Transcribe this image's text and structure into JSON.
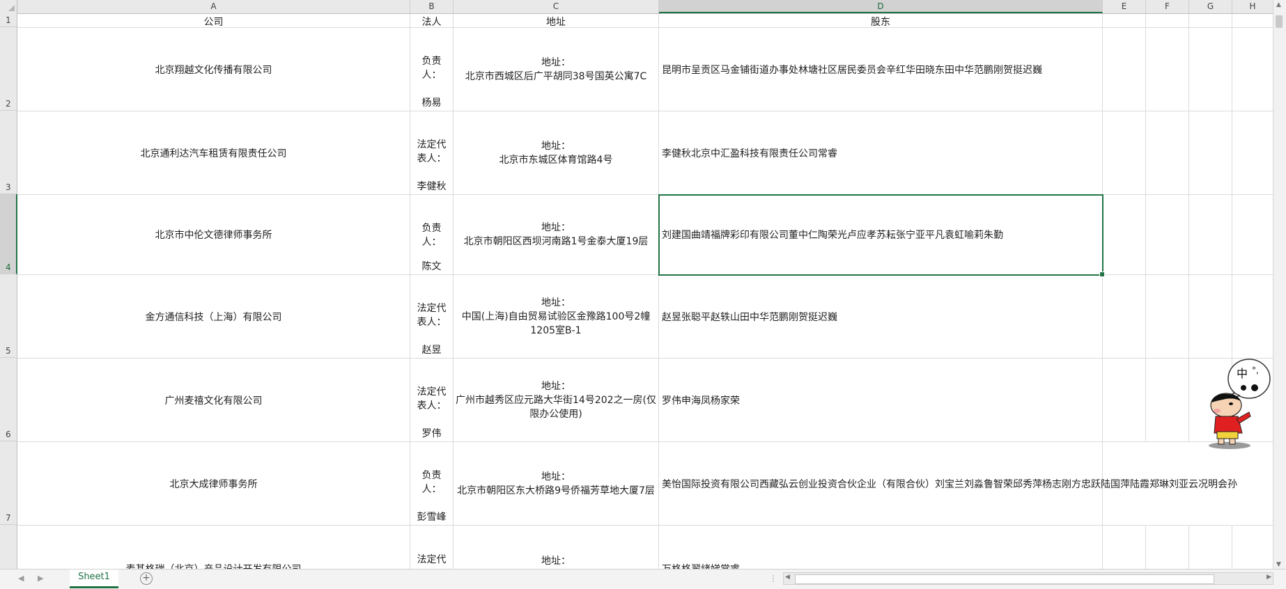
{
  "columns": [
    "A",
    "B",
    "C",
    "D",
    "E",
    "F",
    "G",
    "H"
  ],
  "active_column": "D",
  "row_numbers": [
    "1",
    "2",
    "3",
    "4",
    "5",
    "6",
    "7"
  ],
  "active_row": "4",
  "headers": {
    "company": "公司",
    "person": "法人",
    "address": "地址",
    "shareholder": "股东"
  },
  "rows": [
    {
      "company": "北京翔越文化传播有限公司",
      "role": "负责人：",
      "person": "杨易",
      "address_label": "地址：",
      "address": "北京市西城区后广平胡同38号国英公寓7C",
      "shareholder": "昆明市呈贡区马金铺街道办事处林塘社区居民委员会辛红华田晓东田中华范鹏刚贺挺迟巍"
    },
    {
      "company": "北京通利达汽车租赁有限责任公司",
      "role": "法定代表人：",
      "person": "李健秋",
      "address_label": "地址：",
      "address": "北京市东城区体育馆路4号",
      "shareholder": "李健秋北京中汇盈科技有限责任公司常睿"
    },
    {
      "company": "北京市中伦文德律师事务所",
      "role": "负责人：",
      "person": "陈文",
      "address_label": "地址：",
      "address": "北京市朝阳区西坝河南路1号金泰大厦19层",
      "shareholder": "刘建国曲靖福牌彩印有限公司董中仁陶荣光卢应孝苏耘张宁亚平凡袁虹喻莉朱勤"
    },
    {
      "company": "金方通信科技（上海）有限公司",
      "role": "法定代表人：",
      "person": "赵昱",
      "address_label": "地址：",
      "address": "中国(上海)自由贸易试验区金豫路100号2幢1205室B-1",
      "shareholder": "赵昱张聪平赵轶山田中华范鹏刚贺挺迟巍"
    },
    {
      "company": "广州麦禧文化有限公司",
      "role": "法定代表人：",
      "person": "罗伟",
      "address_label": "地址：",
      "address": "广州市越秀区应元路大华街14号202之一房(仅限办公使用)",
      "shareholder": "罗伟申海凤杨家荣"
    },
    {
      "company": "北京大成律师事务所",
      "role": "负责人：",
      "person": "彭雪峰",
      "address_label": "地址：",
      "address": "北京市朝阳区东大桥路9号侨福芳草地大厦7层",
      "shareholder": "美怡国际投资有限公司西藏弘云创业投资合伙企业（有限合伙）刘宝兰刘淼鲁智荣邱秀萍杨志刚方忠跃陆国萍陆霞郑琳刘亚云况明会孙"
    },
    {
      "company": "麦基格瑞（北京）产品设计开发有限公司",
      "role": "法定代",
      "person": "",
      "address_label": "地址：",
      "address": "",
      "shareholder": "万格格翟緖娣常睿"
    }
  ],
  "sheet_tab": "Sheet1",
  "sticker": {
    "speech": "中 °, ◖◗ 🐞",
    "icon": "cartoon-boy-sticker"
  },
  "colors": {
    "accent": "#217346",
    "header_bg": "#e9e9e9",
    "grid_line": "#dadada"
  }
}
